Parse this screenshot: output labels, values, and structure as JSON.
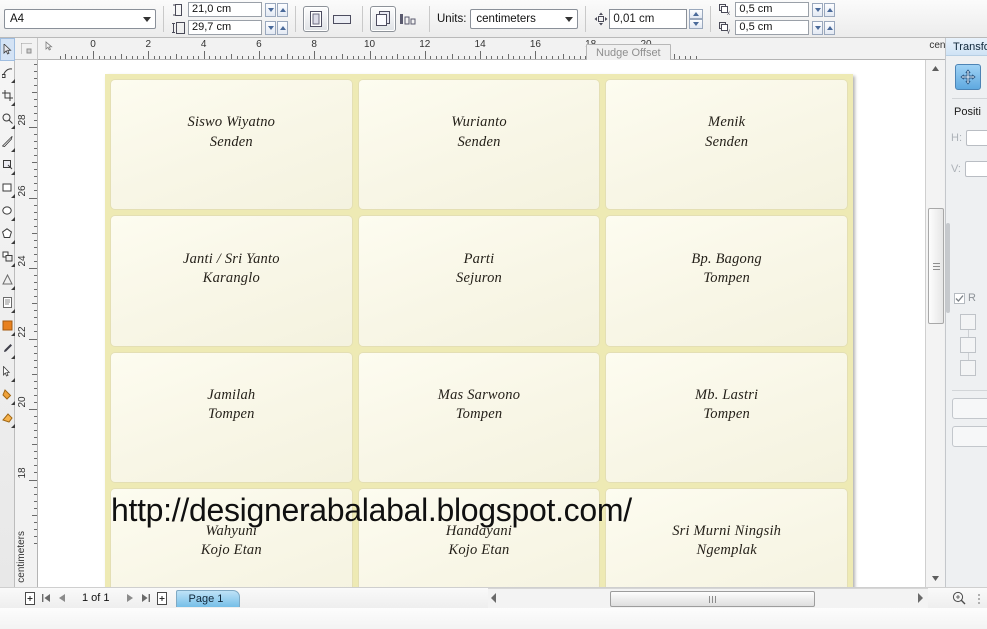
{
  "propbar": {
    "paper_size": "A4",
    "page_width": "21,0 cm",
    "page_height": "29,7 cm",
    "units_label": "Units:",
    "units_value": "centimeters",
    "nudge_offset": "0,01 cm",
    "duplicate_x": "0,5 cm",
    "duplicate_y": "0,5 cm",
    "portrait_tip": "Portrait",
    "landscape_tip": "Landscape",
    "all_pages_tip": "Apply to all pages",
    "current_page_tip": "Apply to current page"
  },
  "rulers": {
    "h_labels": [
      "0",
      "2",
      "4",
      "6",
      "8",
      "10",
      "12",
      "14",
      "16",
      "18",
      "20"
    ],
    "v_labels": [
      "28",
      "26",
      "24",
      "22",
      "20",
      "18"
    ],
    "unit_name": "centimeters"
  },
  "tooltip": {
    "text": "Nudge Offset"
  },
  "toolbox": {
    "tools": [
      {
        "name": "pick-tool"
      },
      {
        "name": "shape-tool"
      },
      {
        "name": "crop-tool"
      },
      {
        "name": "zoom-tool"
      },
      {
        "name": "freehand-tool"
      },
      {
        "name": "smart-fill-tool"
      },
      {
        "name": "rectangle-tool"
      },
      {
        "name": "ellipse-tool"
      },
      {
        "name": "polygon-tool"
      },
      {
        "name": "basic-shapes-tool"
      },
      {
        "name": "text-tool"
      },
      {
        "name": "table-tool"
      },
      {
        "name": "dimension-tool"
      },
      {
        "name": "connector-tool"
      },
      {
        "name": "blend-tool"
      },
      {
        "name": "color-eyedropper-tool"
      },
      {
        "name": "outline-tool"
      },
      {
        "name": "fill-tool"
      },
      {
        "name": "interactive-fill-tool"
      }
    ]
  },
  "document": {
    "watermark": "http://designerabalabal.blogspot.com/",
    "cards": [
      {
        "name": "Siswo Wiyatno",
        "place": "Senden"
      },
      {
        "name": "Wurianto",
        "place": "Senden"
      },
      {
        "name": "Menik",
        "place": "Senden"
      },
      {
        "name": "Janti / Sri Yanto",
        "place": "Karanglo"
      },
      {
        "name": "Parti",
        "place": "Sejuron"
      },
      {
        "name": "Bp. Bagong",
        "place": "Tompen"
      },
      {
        "name": "Jamilah",
        "place": "Tompen"
      },
      {
        "name": "Mas Sarwono",
        "place": "Tompen"
      },
      {
        "name": "Mb. Lastri",
        "place": "Tompen"
      },
      {
        "name": "Wahyuni",
        "place": "Kojo Etan"
      },
      {
        "name": "Handayani",
        "place": "Kojo Etan"
      },
      {
        "name": "Sri Murni Ningsih",
        "place": "Ngemplak"
      }
    ]
  },
  "statusbar": {
    "page_count": "1 of 1",
    "page_tab": "Page 1",
    "first_page_tip": "First page",
    "prev_page_tip": "Previous page",
    "next_page_tip": "Next page",
    "last_page_tip": "Last page",
    "add_page_before_tip": "Add page before",
    "add_page_after_tip": "Add page after"
  },
  "docker": {
    "title": "Transfo",
    "position_label": "Positi",
    "h_label": "H:",
    "v_label": "V:",
    "relative_label": "R",
    "h_value": "",
    "v_value": ""
  },
  "colors": {
    "page_border": "#eeeab4",
    "card_fill": "#fbf9ec",
    "tab_accent": "#76bfe8",
    "docker_accent": "#5fa9e0"
  }
}
